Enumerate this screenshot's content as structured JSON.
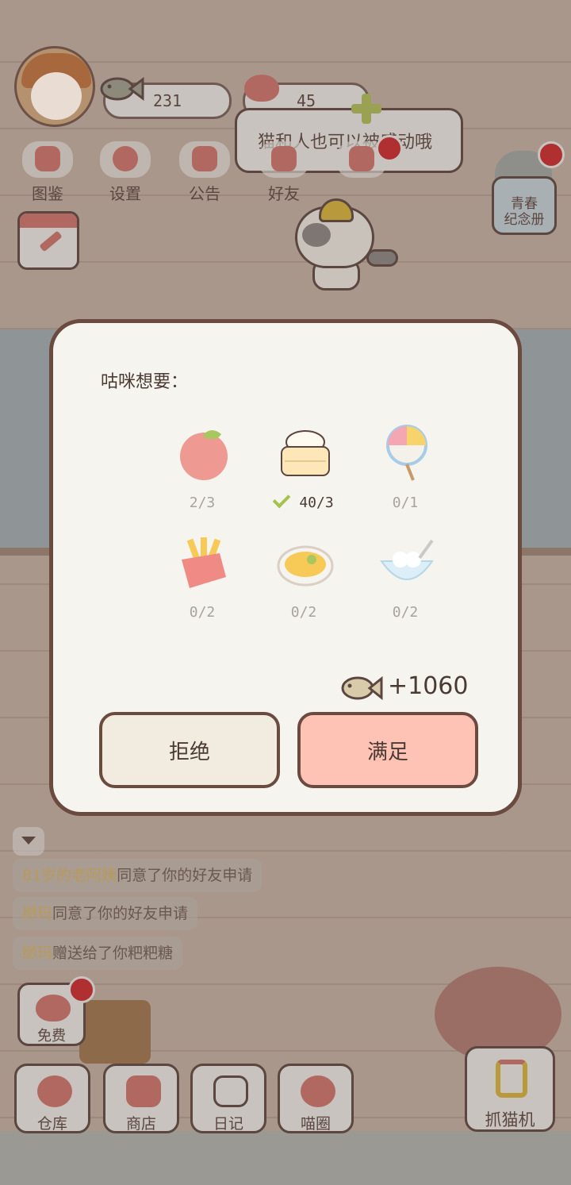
{
  "hud": {
    "fish_count": "231",
    "heart_count": "45",
    "bubble_text": "猫和人也可以被感动哦"
  },
  "menu": [
    {
      "label": "图鉴"
    },
    {
      "label": "设置"
    },
    {
      "label": "公告"
    },
    {
      "label": "好友"
    }
  ],
  "album": {
    "label": "青春\n纪念册"
  },
  "modal": {
    "title": "咕咪想要：",
    "items": [
      {
        "name": "peach",
        "count": "2/3",
        "fulfilled": false
      },
      {
        "name": "steamed-bun",
        "count": "40/3",
        "fulfilled": true
      },
      {
        "name": "lollipop",
        "count": "0/1",
        "fulfilled": false
      },
      {
        "name": "fries",
        "count": "0/2",
        "fulfilled": false
      },
      {
        "name": "noodles",
        "count": "0/2",
        "fulfilled": false
      },
      {
        "name": "rice-ball-soup",
        "count": "0/2",
        "fulfilled": false
      }
    ],
    "reward": "+1060",
    "reject_label": "拒绝",
    "accept_label": "满足"
  },
  "chat": [
    {
      "who": "81岁的老阿姨",
      "text": "同意了你的好友申请"
    },
    {
      "who": "缈玛",
      "text": "同意了你的好友申请"
    },
    {
      "who": "缈玛",
      "text": "赠送给了你粑粑糖"
    }
  ],
  "nav": {
    "free": "免费",
    "warehouse": "仓库",
    "shop": "商店",
    "diary": "日记",
    "circle": "喵圈",
    "claw": "抓猫机"
  },
  "colors": {
    "accent_red": "#b02f30",
    "accept_bg": "#ffc3b5",
    "reject_bg": "#f2ece0",
    "modal_border": "#6b4a40"
  }
}
